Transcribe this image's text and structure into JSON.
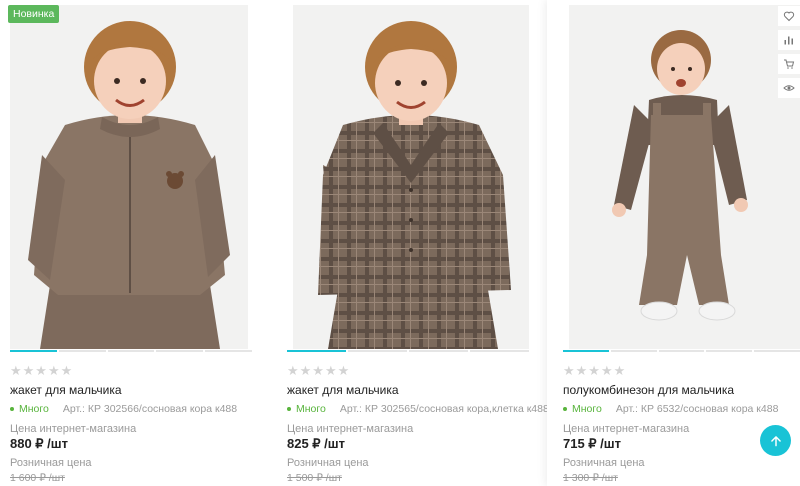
{
  "products": [
    {
      "badge": "Новинка",
      "image": "child-in-brown-zip-jacket",
      "stars": "★★★★★",
      "name": "жакет для мальчика",
      "stock": "Много",
      "article": "Арт.: КР 302566/сосновая кора к488",
      "price_label": "Цена интернет-магазина",
      "price": "880 ₽ /шт",
      "retail_label": "Розничная цена",
      "old_price": "1 600 ₽ /шт"
    },
    {
      "image": "child-in-brown-plaid-shirt-jacket",
      "stars": "★★★★★",
      "name": "жакет для мальчика",
      "stock": "Много",
      "article": "Арт.: КР 302565/сосновая кора,клетка к488",
      "price_label": "Цена интернет-магазина",
      "price": "825 ₽ /шт",
      "retail_label": "Розничная цена",
      "old_price": "1 500 ₽ /шт"
    },
    {
      "image": "child-in-brown-overalls",
      "stars": "★★★★★",
      "name": "полукомбинезон для мальчика",
      "stock": "Много",
      "article": "Арт.: КР 6532/сосновая кора к488",
      "price_label": "Цена интернет-магазина",
      "price": "715 ₽ /шт",
      "retail_label": "Розничная цена",
      "old_price": "1 300 ₽ /шт"
    }
  ],
  "side_actions": [
    "heart-icon",
    "compare-icon",
    "cart-icon",
    "eye-icon"
  ],
  "scroll_top_icon": "arrow-up-icon",
  "colors": {
    "accent": "#19c3d6",
    "badge": "#5cb85c",
    "in_stock": "#58b43c",
    "muted": "#9a9a9a",
    "product_brown": "#8a7565"
  }
}
